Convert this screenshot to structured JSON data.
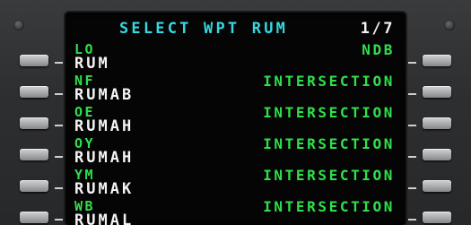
{
  "display": {
    "title": "SELECT WPT RUM",
    "page": "1/7"
  },
  "waypoints": [
    {
      "ident": "LO",
      "name": "RUM",
      "type": "NDB"
    },
    {
      "ident": "NF",
      "name": "RUMAB",
      "type": "INTERSECTION"
    },
    {
      "ident": "OE",
      "name": "RUMAH",
      "type": "INTERSECTION"
    },
    {
      "ident": "OY",
      "name": "RUMAH",
      "type": "INTERSECTION"
    },
    {
      "ident": "YM",
      "name": "RUMAK",
      "type": "INTERSECTION"
    },
    {
      "ident": "WB",
      "name": "RUMAL",
      "type": "INTERSECTION"
    }
  ],
  "colors": {
    "title": "#37d8e0",
    "green": "#2fe04a",
    "white": "#f4f4f4"
  }
}
